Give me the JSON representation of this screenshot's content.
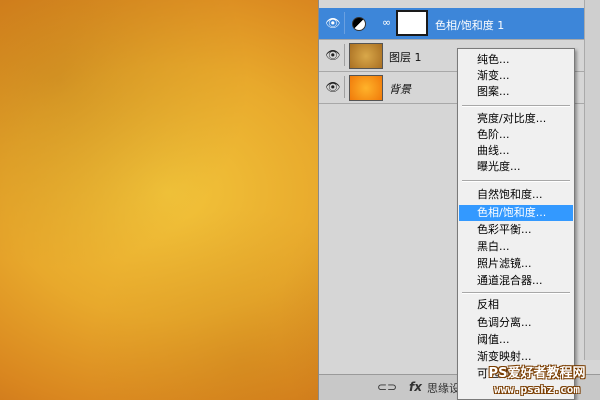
{
  "layers_panel": {
    "layers": [
      {
        "name": "色相/饱和度 1",
        "type": "adjustment",
        "selected": true
      },
      {
        "name": "图层 1",
        "type": "texture",
        "selected": false
      },
      {
        "name": "背景",
        "type": "background",
        "selected": false
      }
    ],
    "bottom_bar": {
      "link_icon": "link-icon",
      "fx_label": "fx",
      "partial_text": "思缘设计论坛"
    }
  },
  "adjustment_menu": {
    "items": [
      "纯色...",
      "渐变...",
      "图案...",
      "亮度/对比度...",
      "色阶...",
      "曲线...",
      "曝光度...",
      "自然饱和度...",
      "色相/饱和度...",
      "色彩平衡...",
      "黑白...",
      "照片滤镜...",
      "通道混合器...",
      "反相",
      "色调分离...",
      "阈值...",
      "渐变映射...",
      "可选颜色..."
    ],
    "highlighted": "色相/饱和度..."
  },
  "watermark": {
    "title": "PS爱好者教程网",
    "url": "www.psahz.com"
  },
  "colors": {
    "selection_blue": "#3d86d9",
    "menu_highlight": "#3399ff",
    "panel_gray": "#d6d6d6"
  }
}
